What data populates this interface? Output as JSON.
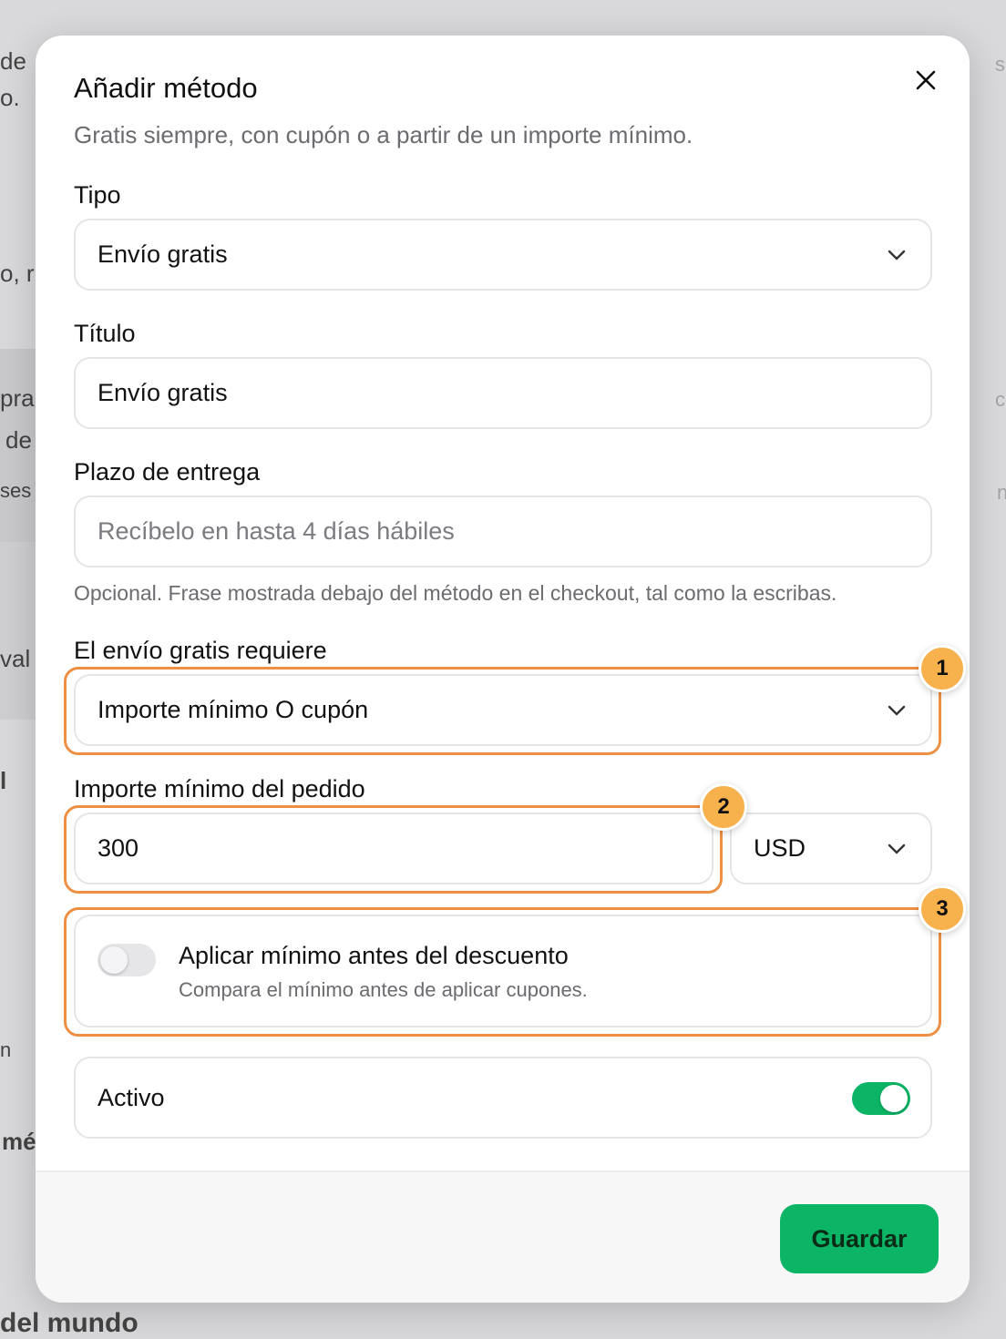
{
  "modal": {
    "title": "Añadir método",
    "subtitle": "Gratis siempre, con cupón o a partir de un importe mínimo."
  },
  "form": {
    "tipo": {
      "label": "Tipo",
      "value": "Envío gratis"
    },
    "titulo": {
      "label": "Título",
      "value": "Envío gratis"
    },
    "plazo": {
      "label": "Plazo de entrega",
      "placeholder": "Recíbelo en hasta 4 días hábiles",
      "hint": "Opcional. Frase mostrada debajo del método en el checkout, tal como la escribas."
    },
    "requiere": {
      "label": "El envío gratis requiere",
      "value": "Importe mínimo O cupón"
    },
    "importe": {
      "label": "Importe mínimo del pedido",
      "value": "300",
      "currency": "USD"
    },
    "aplicar_minimo": {
      "title": "Aplicar mínimo antes del descuento",
      "description": "Compara el mínimo antes de aplicar cupones.",
      "enabled": false
    },
    "activo": {
      "label": "Activo",
      "enabled": true
    }
  },
  "footer": {
    "save_label": "Guardar"
  },
  "annotations": [
    "1",
    "2",
    "3"
  ],
  "colors": {
    "accent": "#0bb565",
    "highlight": "#ee9043",
    "badge": "#f8b24d"
  },
  "background": {
    "fragments": [
      "de",
      "o.",
      "o, r",
      "pra",
      "de",
      "ses",
      "val",
      "l",
      "n",
      "mé",
      "del mundo",
      "s",
      "c",
      "n"
    ]
  }
}
